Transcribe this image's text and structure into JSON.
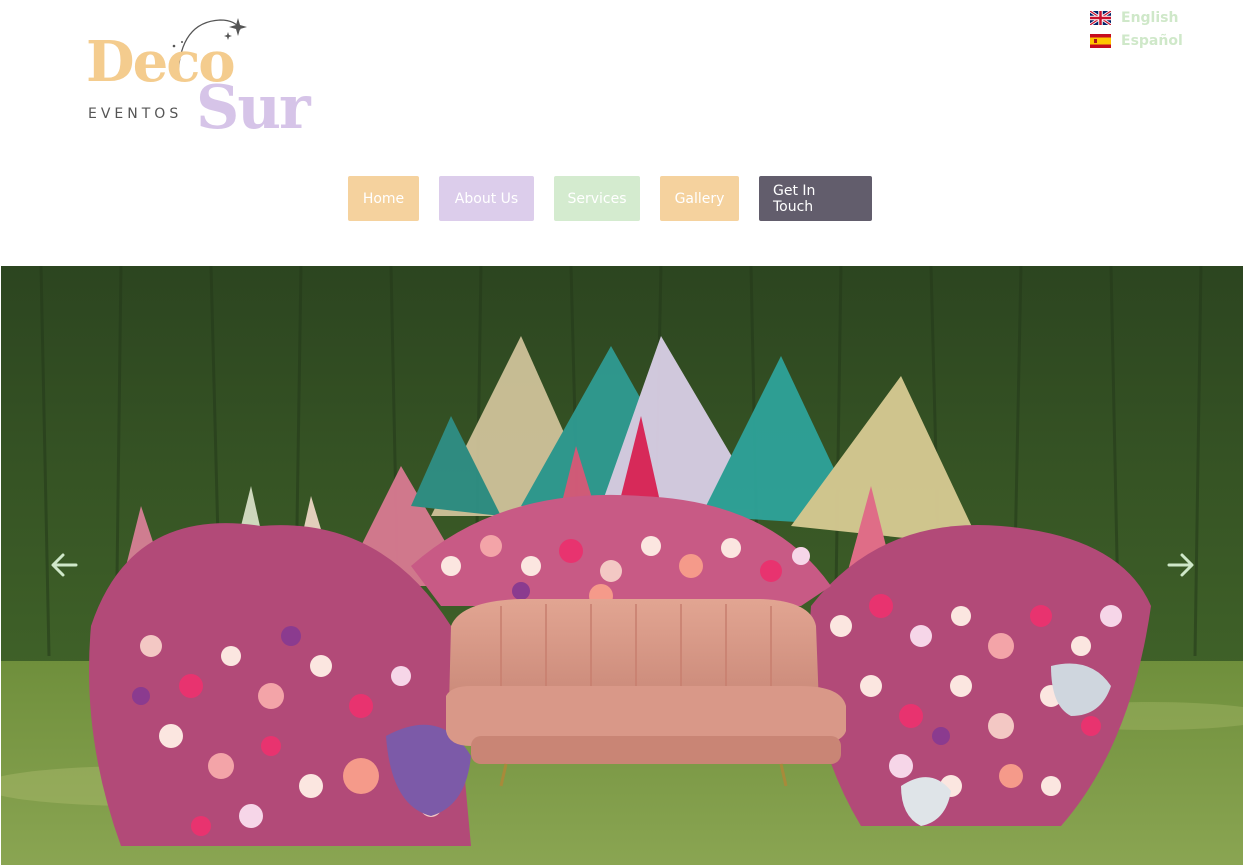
{
  "logo": {
    "word1": "Deco",
    "word2": "Sur",
    "subtitle": "EVENTOS"
  },
  "language": {
    "items": [
      {
        "label": "English",
        "flag": "uk-flag-icon"
      },
      {
        "label": "Español",
        "flag": "spain-flag-icon"
      }
    ],
    "color": "#cfe8c9"
  },
  "nav": {
    "items": [
      {
        "label": "Home",
        "color": "#f5d29e"
      },
      {
        "label": "About Us",
        "color": "#dccdeb"
      },
      {
        "label": "Services",
        "color": "#d4ebcf"
      },
      {
        "label": "Gallery",
        "color": "#f5d29e"
      },
      {
        "label": "Get In Touch",
        "color": "#625d6c"
      }
    ]
  },
  "slider": {
    "image": "pink-velvet-sofa-with-dried-flower-arrangement",
    "prev_icon": "arrow-left-icon",
    "next_icon": "arrow-right-icon",
    "arrow_color": "#cfe8c9"
  }
}
